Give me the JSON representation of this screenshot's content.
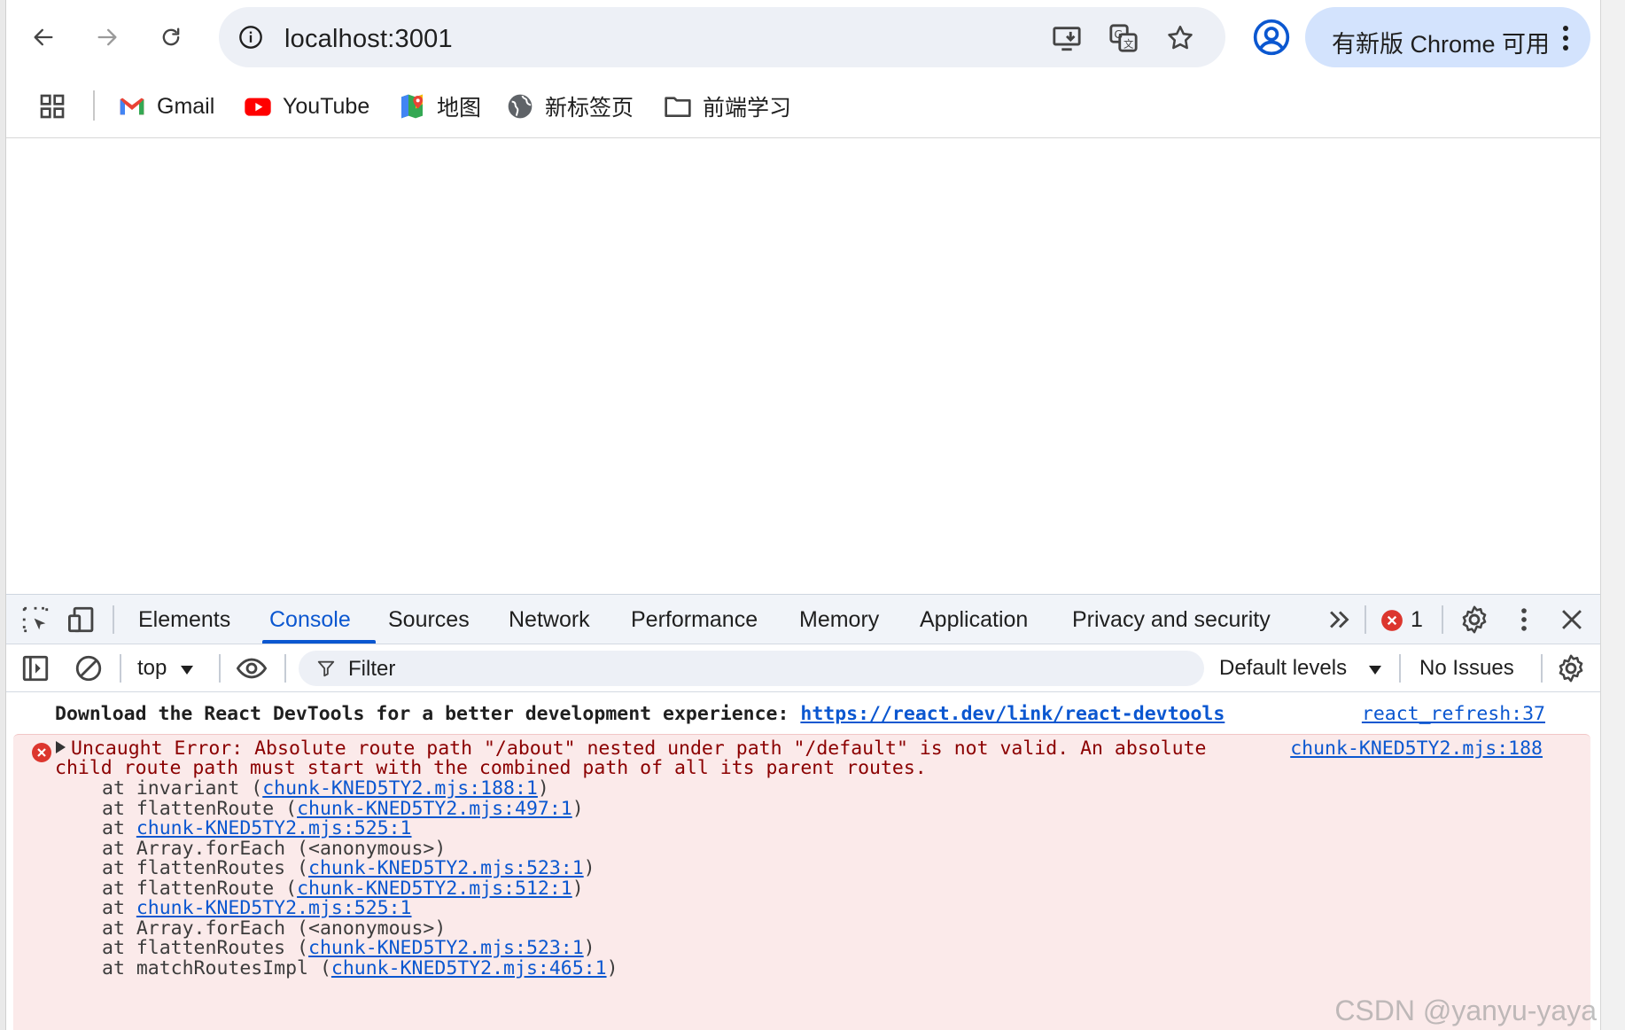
{
  "browser": {
    "url": "localhost:3001",
    "update_label": "有新版 Chrome 可用",
    "bookmarks": [
      {
        "label": "Gmail",
        "icon": "gmail-icon"
      },
      {
        "label": "YouTube",
        "icon": "youtube-icon"
      },
      {
        "label": "地图",
        "icon": "maps-icon"
      },
      {
        "label": "新标签页",
        "icon": "globe-icon"
      },
      {
        "label": "前端学习",
        "icon": "folder-icon"
      }
    ]
  },
  "devtools": {
    "tabs": [
      "Elements",
      "Console",
      "Sources",
      "Network",
      "Performance",
      "Memory",
      "Application",
      "Privacy and security"
    ],
    "active_tab": "Console",
    "error_count": "1",
    "context": "top",
    "filter_placeholder": "Filter",
    "levels": "Default levels",
    "issues": "No Issues"
  },
  "console": {
    "info": {
      "text": "Download the React DevTools for a better development experience: ",
      "link": "https://react.dev/link/react-devtools",
      "source": "react_refresh:37"
    },
    "error": {
      "line1": "Uncaught Error: Absolute route path \"/about\" nested under path \"/default\" is not valid. An absolute",
      "line2": "child route path must start with the combined path of all its parent routes.",
      "source": "chunk-KNED5TY2.mjs:188",
      "stack": [
        {
          "prefix": "at invariant (",
          "link": "chunk-KNED5TY2.mjs:188:1",
          "suffix": ")"
        },
        {
          "prefix": "at flattenRoute (",
          "link": "chunk-KNED5TY2.mjs:497:1",
          "suffix": ")"
        },
        {
          "prefix": "at ",
          "link": "chunk-KNED5TY2.mjs:525:1",
          "suffix": ""
        },
        {
          "prefix": "at Array.forEach (<anonymous>)",
          "link": "",
          "suffix": ""
        },
        {
          "prefix": "at flattenRoutes (",
          "link": "chunk-KNED5TY2.mjs:523:1",
          "suffix": ")"
        },
        {
          "prefix": "at flattenRoute (",
          "link": "chunk-KNED5TY2.mjs:512:1",
          "suffix": ")"
        },
        {
          "prefix": "at ",
          "link": "chunk-KNED5TY2.mjs:525:1",
          "suffix": ""
        },
        {
          "prefix": "at Array.forEach (<anonymous>)",
          "link": "",
          "suffix": ""
        },
        {
          "prefix": "at flattenRoutes (",
          "link": "chunk-KNED5TY2.mjs:523:1",
          "suffix": ")"
        },
        {
          "prefix": "at matchRoutesImpl (",
          "link": "chunk-KNED5TY2.mjs:465:1",
          "suffix": ")"
        }
      ]
    }
  },
  "watermark": "CSDN @yanyu-yaya"
}
